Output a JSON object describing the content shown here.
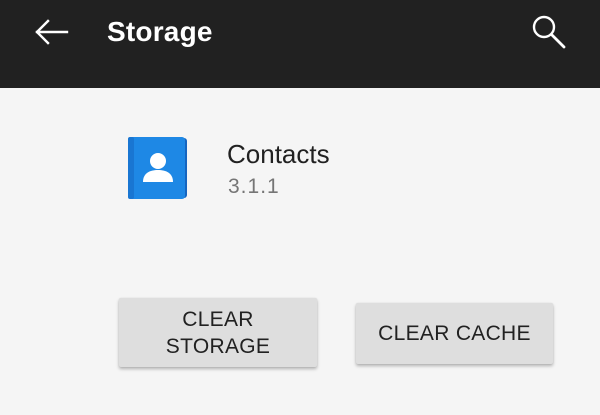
{
  "toolbar": {
    "title": "Storage",
    "back_icon": "arrow-back-icon",
    "search_icon": "search-icon",
    "background": "#212121"
  },
  "app": {
    "name": "Contacts",
    "version": "3.1.1",
    "icon": "contacts-icon",
    "icon_color": "#1e88e5"
  },
  "buttons": {
    "clear_storage": "CLEAR\nSTORAGE",
    "clear_cache": "CLEAR CACHE"
  }
}
